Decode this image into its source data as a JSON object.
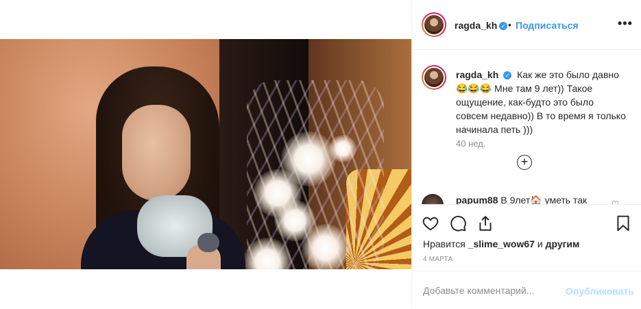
{
  "post": {
    "author": "ragda_kh",
    "follow_label": "Подписаться",
    "separator": "•",
    "more_label": "•••",
    "verified_mark": "✓"
  },
  "caption": {
    "author": "ragda_kh",
    "text": "Как же это было давно😂😂😂 Мне там 9 лет)) Такое ощущение, как-будто это было совсем недавно)) В то время я только начинала петь )))",
    "time": "40 нед.",
    "load_more": "+"
  },
  "reply": {
    "author": "papum88",
    "text": "В 9лет🏠 уметь так",
    "heart": "♡"
  },
  "likes": {
    "prefix": "Нравится",
    "user": "_slime_wow67",
    "suffix": "и",
    "others": "другим"
  },
  "date": "4 марта",
  "comment_box": {
    "placeholder": "Добавьте комментарий...",
    "publish_label": "Опубликовать"
  },
  "icons": {
    "like": "heart-icon",
    "comment": "comment-icon",
    "share": "share-icon",
    "save": "bookmark-icon",
    "more": "more-icon"
  },
  "colors": {
    "accent": "#3897f0",
    "publish_disabled": "#b2dffc",
    "secondary_text": "#8e8e8e"
  }
}
